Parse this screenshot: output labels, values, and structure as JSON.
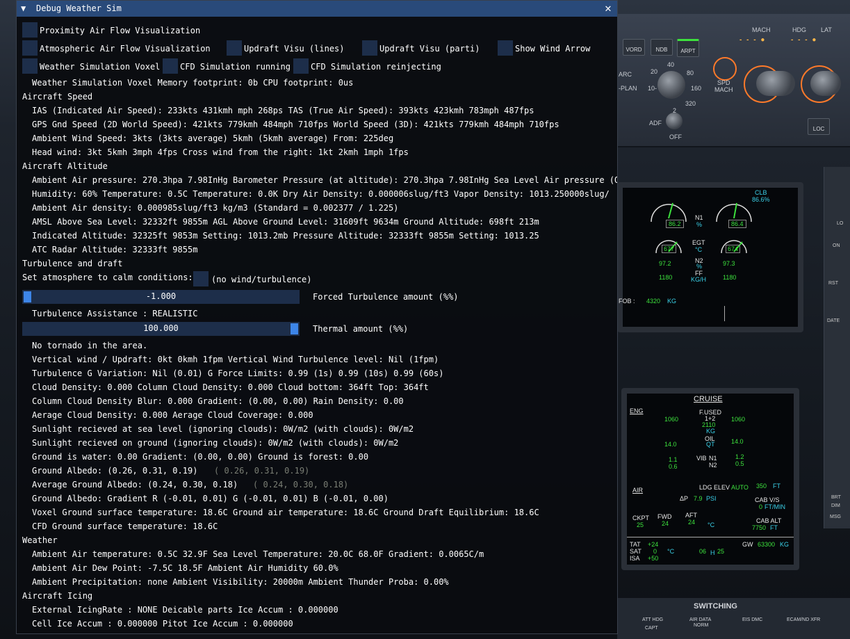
{
  "window": {
    "title": "Debug Weather Sim",
    "collapse_icon": "triangle-down-icon",
    "close_icon": "close-icon"
  },
  "checkboxes": {
    "proximity": "Proximity Air Flow Visualization",
    "atmospheric": "Atmospheric Air Flow Visualization",
    "updraft_lines": "Updraft Visu (lines)",
    "updraft_parti": "Updraft Visu (parti)",
    "wind_arrow": "Show Wind Arrow",
    "voxel": "Weather Simulation Voxel",
    "cfd_running": "CFD Simulation running",
    "cfd_reinject": "CFD Simulation reinjecting"
  },
  "lines": {
    "voxel_mem": "Weather Simulation Voxel Memory footprint: 0b   CPU footprint: 0us",
    "sec_speed": "Aircraft Speed",
    "ias": "IAS (Indicated Air Speed): 233kts 431kmh mph 268ps  TAS (True Air Speed): 393kts 423kmh 783mph 487fps",
    "gps": "GPS Gnd Speed (2D World Speed): 421kts 779kmh 484mph 710fps  World Speed (3D): 421kts 779kmh 484mph 710fps",
    "wind": "Ambient Wind Speed: 3kts (3kts average) 5kmh (5kmh average)   From:  225deg",
    "headwind": "Head wind: 3kt 5kmh 3mph 4fps   Cross wind from the right: 1kt 2kmh 1mph 1fps",
    "sec_alt": "Aircraft Altitude",
    "pressure": "Ambient Air pressure: 270.3hpa 7.98InHg  Barometer Pressure (at altitude): 270.3hpa 7.98InHg   Sea Level Air pressure (QN",
    "humidity": "Humidity: 60%  Temperature: 0.5C  Temperature: 0.0K   Dry Air Density: 0.000006slug/ft3   Vapor Density: 1013.250000slug/",
    "density": "Ambient Air density: 0.000985slug/ft3 kg/m3 (Standard = 0.002377 / 1.225)",
    "amsl": "AMSL Above Sea Level: 32332ft 9855m   AGL Above Ground Level: 31609ft 9634m   Ground Altitude: 698ft 213m",
    "indicated": "Indicated Altitude: 32325ft 9853m  Setting: 1013.2mb  Pressure Altitude: 32333ft 9855m  Setting: 1013.25",
    "atc": "ATC Radar Altitude: 32333ft 9855m",
    "sec_turb": "Turbulence and draft",
    "calm_label": "Set atmosphere to calm conditions:",
    "calm_note": "(no wind/turbulence)",
    "turb_assist": "Turbulence Assistance : REALISTIC",
    "tornado": "No tornado in the area.",
    "vertical": "Vertical wind / Updraft: 0kt 0kmh 1fpm   Vertical Wind Turbulence level: Nil (1fpm)",
    "gvar": "Turbulence G Variation: Nil (0.01)    G Force Limits: 0.99 (1s)  0.99 (10s)  0.99 (60s)",
    "cloud": "Cloud Density: 0.000   Column Cloud Density: 0.000  Cloud bottom: 364ft   Top: 364ft",
    "colblur": "Column Cloud Density Blur: 0.000    Gradient: (0.00, 0.00)    Rain Density: 0.00",
    "avgcloud": "Aerage Cloud Density: 0.000    Aerage Cloud Coverage: 0.000",
    "sun_sea": "Sunlight recieved at sea level (ignoring clouds): 0W/m2  (with clouds): 0W/m2",
    "sun_gnd": "Sunlight recieved on ground (ignoring clouds): 0W/m2  (with clouds): 0W/m2",
    "water": "Ground is water: 0.00   Gradient: (0.00, 0.00)  Ground is forest: 0.00",
    "albedo": "Ground Albedo: (0.26, 0.31, 0.19)",
    "albedo_muted": "( 0.26,  0.31,  0.19)",
    "avgalbedo": "Average Ground Albedo: (0.24, 0.30, 0.18)",
    "avgalbedo_muted": "( 0.24,  0.30,  0.18)",
    "albgrad": "Ground Albedo: Gradient R (-0.01, 0.01) G (-0.01, 0.01) B (-0.01, 0.00)",
    "voxelgnd": "Voxel Ground surface temperature: 18.6C  Ground air temperature: 18.6C  Ground Draft Equilibrium: 18.6C",
    "cfdgnd": "CFD Ground surface temperature: 18.6C",
    "sec_weather": "Weather",
    "airtemp": "Ambient Air temperature: 0.5C 32.9F    Sea Level Temperature: 20.0C 68.0F  Gradient: 0.0065C/m",
    "dew": "Ambient Air Dew Point: -7.5C 18.5F   Ambient Air Humidity 60.0%",
    "precip": "Ambient Precipitation: none   Ambient Visibility: 20000m   Ambient Thunder Proba: 0.00%",
    "sec_icing": "Aircraft Icing",
    "icing": "External IcingRate : NONE   Deicable parts Ice Accum : 0.000000",
    "cell": "Cell Ice Accum : 0.000000   Pitot Ice Accum : 0.000000"
  },
  "sliders": {
    "turbulence": {
      "value_text": "-1.000",
      "label": "Forced Turbulence amount (%%)",
      "fraction": 0.0
    },
    "thermal": {
      "value_text": "100.000",
      "label": "Thermal amount (%%)",
      "fraction": 1.0
    }
  },
  "cockpit": {
    "fcu": {
      "mach": "MACH",
      "hdg": "HDG",
      "lat": "LAT",
      "vord": "VORD",
      "ndb": "NDB",
      "arpt": "ARPT",
      "arc": "ARC",
      "plan": "-PLAN",
      "spd": "SPD",
      "mach2": "MACH",
      "adf": "ADF",
      "off": "OFF",
      "loc": "LOC",
      "r20": "20",
      "r40": "40",
      "r80": "80",
      "r10": "10-",
      "r160": "160",
      "r320": "320",
      "two": "2"
    },
    "upper_ecam": {
      "clb": "CLB",
      "clb_val": "86.6%",
      "n1l": "86.2",
      "n1": "N1",
      "pct": "%",
      "n1r": "86.4",
      "egtl": "677",
      "egt": "EGT",
      "degc": "°C",
      "egtr": "674",
      "n2l": "97.2",
      "n2": "N2",
      "n2pct": "%",
      "n2r": "97.3",
      "ffl": "1180",
      "ff": "FF",
      "kgh": "KG/H",
      "ffr": "1180",
      "fob": "FOB :",
      "fob_val": "4320",
      "fob_unit": "KG"
    },
    "lower_ecam": {
      "cruise": "CRUISE",
      "eng": "ENG",
      "fused": "F.USED",
      "f12": "1+2",
      "fl": "1060",
      "fr": "1060",
      "ftot": "2110",
      "kg": "KG",
      "oil": "OIL",
      "qt": "QT",
      "oill": "14.0",
      "oilr": "14.0",
      "vib": "VIB",
      "vn1": "N1",
      "vn2": "N2",
      "v1l": "1.1",
      "v2l": "0.6",
      "v1r": "1.2",
      "v2r": "0.5",
      "air": "AIR",
      "ldg": "LDG ELEV",
      "auto": "AUTO",
      "ldg_val": "350",
      "ft": "FT",
      "dp": "ΔP",
      "dp_val": "7.9",
      "psi": "PSI",
      "cabvs": "CAB V/S",
      "cabvs_val": "0",
      "ftmin": "FT/MIN",
      "cabalt": "CAB ALT",
      "cabalt_val": "7750",
      "ft2": "FT",
      "ckpt": "CKPT",
      "fwd": "FWD",
      "aft": "AFT",
      "t1": "25",
      "t2": "24",
      "t3": "24",
      "degc": "°C",
      "tat": "TAT",
      "sat": "SAT",
      "isa": "ISA",
      "tatv": "+24",
      "satv": "0",
      "isav": "+50",
      "deg": "°C",
      "time": "06",
      "h": "H",
      "time2": "25",
      "gw": "GW",
      "gw_val": "63300",
      "gwkg": "KG"
    },
    "bottom": {
      "switching": "SWITCHING",
      "atthdg": "ATT HDG",
      "airdata": "AIR DATA",
      "eis": "EIS DMC",
      "ecam": "ECAM/ND XFR",
      "norm": "NORM",
      "capt": "CAPT"
    },
    "side": {
      "lo": "LO",
      "rst": "RST",
      "date": "DATE",
      "on": "ON",
      "brt": "BRT",
      "dim": "DIM",
      "msg": "MSG"
    }
  }
}
